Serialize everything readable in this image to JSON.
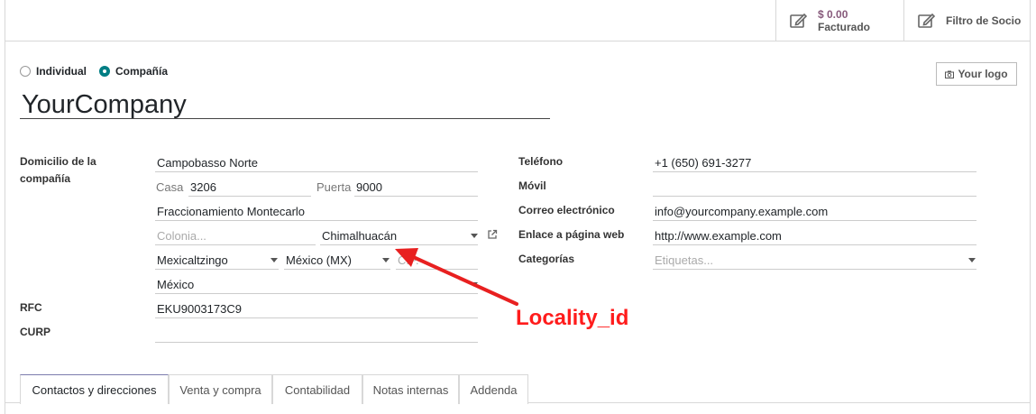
{
  "smart_buttons": {
    "invoiced_amount": "$ 0.00",
    "invoiced_label": "Facturado",
    "partner_filter_label": "Filtro de Socio"
  },
  "company_type": {
    "options": [
      "Individual",
      "Compañía"
    ],
    "selected": "Compañía"
  },
  "logo_button": "Your logo",
  "company_name": "YourCompany",
  "address": {
    "label": "Domicilio de la compañía",
    "street": "Campobasso Norte",
    "house_label": "Casa",
    "house_value": "3206",
    "door_label": "Puerta",
    "door_value": "9000",
    "street2": "Fraccionamiento Montecarlo",
    "colony_placeholder": "Colonia...",
    "locality": "Chimalhuacán",
    "city": "Mexicaltzingo",
    "state": "México (MX)",
    "zip_partial": "C.P.",
    "country": "México"
  },
  "rfc": {
    "label": "RFC",
    "value": "EKU9003173C9"
  },
  "curp": {
    "label": "CURP",
    "value": ""
  },
  "contact": {
    "phone_label": "Teléfono",
    "phone_value": "+1 (650) 691-3277",
    "mobile_label": "Móvil",
    "mobile_value": "",
    "email_label": "Correo electrónico",
    "email_value": "info@yourcompany.example.com",
    "website_label": "Enlace a página web",
    "website_value": "http://www.example.com",
    "tags_label": "Categorías",
    "tags_placeholder": "Etiquetas..."
  },
  "annotation": {
    "text": "Locality_id",
    "color": "#ff1c1c"
  },
  "tabs": [
    {
      "label": "Contactos y direcciones",
      "active": true
    },
    {
      "label": "Venta y compra",
      "active": false
    },
    {
      "label": "Contabilidad",
      "active": false
    },
    {
      "label": "Notas internas",
      "active": false
    },
    {
      "label": "Addenda",
      "active": false
    }
  ],
  "colors": {
    "accent": "#875a7b",
    "radio_checked": "#017e84"
  }
}
